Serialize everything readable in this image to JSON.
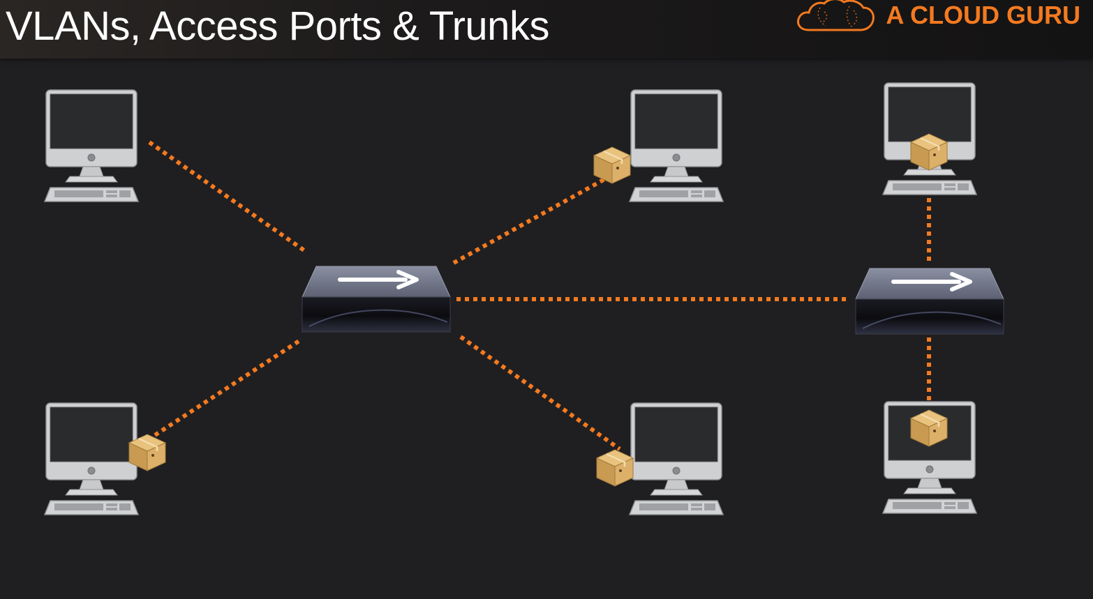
{
  "header": {
    "title": "VLANs, Access Ports & Trunks",
    "brand": "A CLOUD GURU",
    "brand_icon": "cloud-logo-icon"
  },
  "colors": {
    "link": "#f47a20",
    "brand": "#f47a20",
    "background": "#1f1f21",
    "title": "#ffffff"
  },
  "diagram": {
    "nodes": [
      {
        "id": "pc-top-left",
        "type": "computer",
        "icon": "computer-icon"
      },
      {
        "id": "pc-bottom-left",
        "type": "computer",
        "icon": "computer-icon",
        "packet": true
      },
      {
        "id": "pc-top-middle",
        "type": "computer",
        "icon": "computer-icon",
        "packet": true
      },
      {
        "id": "pc-bottom-middle",
        "type": "computer",
        "icon": "computer-icon",
        "packet": true
      },
      {
        "id": "pc-top-right",
        "type": "computer",
        "icon": "computer-icon",
        "packet": true
      },
      {
        "id": "pc-bottom-right",
        "type": "computer",
        "icon": "computer-icon",
        "packet": true
      },
      {
        "id": "switch-left",
        "type": "switch",
        "icon": "switch-icon"
      },
      {
        "id": "switch-right",
        "type": "switch",
        "icon": "switch-icon"
      }
    ],
    "links": [
      {
        "from": "pc-top-left",
        "to": "switch-left",
        "style": "dotted"
      },
      {
        "from": "pc-bottom-left",
        "to": "switch-left",
        "style": "dotted"
      },
      {
        "from": "switch-left",
        "to": "pc-top-middle",
        "style": "dotted"
      },
      {
        "from": "switch-left",
        "to": "pc-bottom-middle",
        "style": "dotted"
      },
      {
        "from": "switch-left",
        "to": "switch-right",
        "style": "dotted"
      },
      {
        "from": "switch-right",
        "to": "pc-top-right",
        "style": "dotted"
      },
      {
        "from": "switch-right",
        "to": "pc-bottom-right",
        "style": "dotted"
      }
    ]
  }
}
